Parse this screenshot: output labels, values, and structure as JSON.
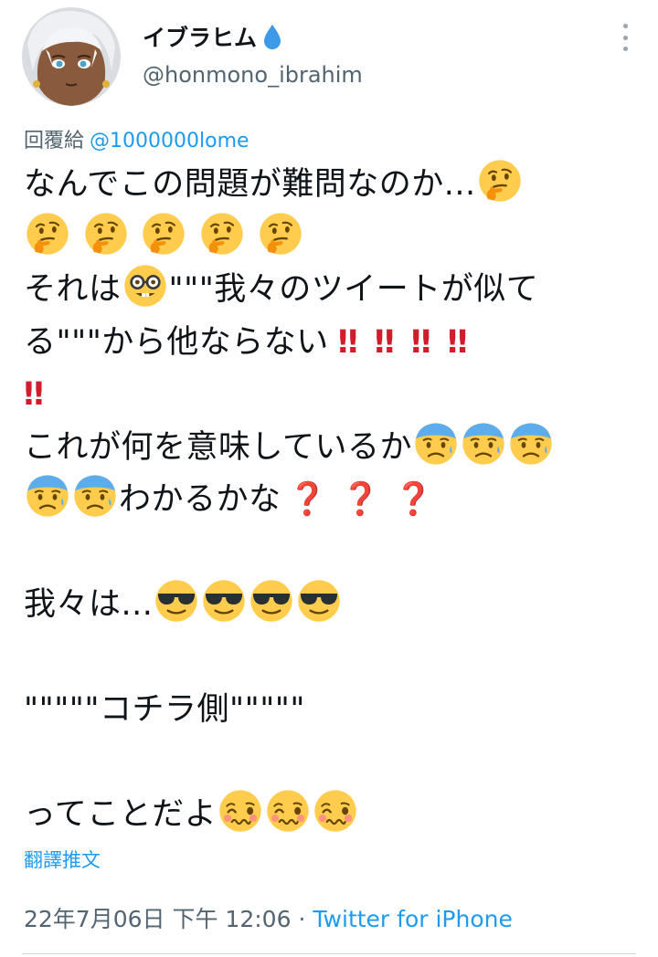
{
  "author": {
    "display_name": "イブラヒム",
    "handle": "@honmono_ibrahim",
    "avatar_icon": "character-avatar-icon",
    "badge_icon": "water-drop-icon"
  },
  "reply": {
    "prefix": "回覆給",
    "mention": "@1000000lome"
  },
  "tweet": {
    "line1_text": "なんでこの問題が難問なのか...",
    "line3_a": "それは",
    "line3_b": "\"\"\"我々のツイートが似て",
    "line4_a": "る\"\"\"から他ならない",
    "bangbang": "‼",
    "line6_a": "これが何を意味しているか",
    "line7_b": "わかるかな",
    "question": "❓",
    "line9_a": "我々は...",
    "line11": "\"\"\"\"\"コチラ側\"\"\"\"\"",
    "line13_a": "ってことだよ"
  },
  "emoji": {
    "thinking": "thinking-face-icon",
    "nerd": "nerd-face-icon",
    "anxious": "anxious-face-icon",
    "cool": "sunglasses-face-icon",
    "woozy": "woozy-face-icon"
  },
  "colors": {
    "link": "#1d9bf0",
    "text": "#0f1419",
    "secondary": "#536471",
    "red": "#d01c2b",
    "emoji_yellow": "#ffcc4d"
  },
  "translate_label": "翻譯推文",
  "meta": {
    "date": "22年7月06日 下午 12:06",
    "separator": "·",
    "source": "Twitter for iPhone"
  }
}
